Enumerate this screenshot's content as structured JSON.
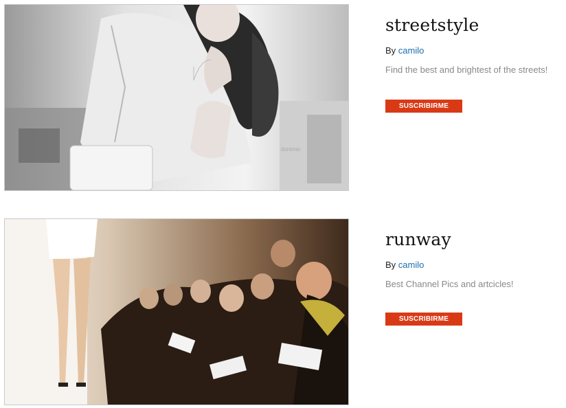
{
  "cards": [
    {
      "title": "streetstyle",
      "by_label": "By",
      "author": "camilo",
      "description": "Find the best and brightest of the streets!",
      "button_label": "SUSCRIBIRME",
      "watermark": "donimei"
    },
    {
      "title": "runway",
      "by_label": "By",
      "author": "camilo",
      "description": "Best Channel Pics and artcicles!",
      "button_label": "SUSCRIBIRME"
    }
  ],
  "colors": {
    "accent": "#d93a16",
    "link": "#1a6fb0",
    "muted_text": "#888888"
  }
}
